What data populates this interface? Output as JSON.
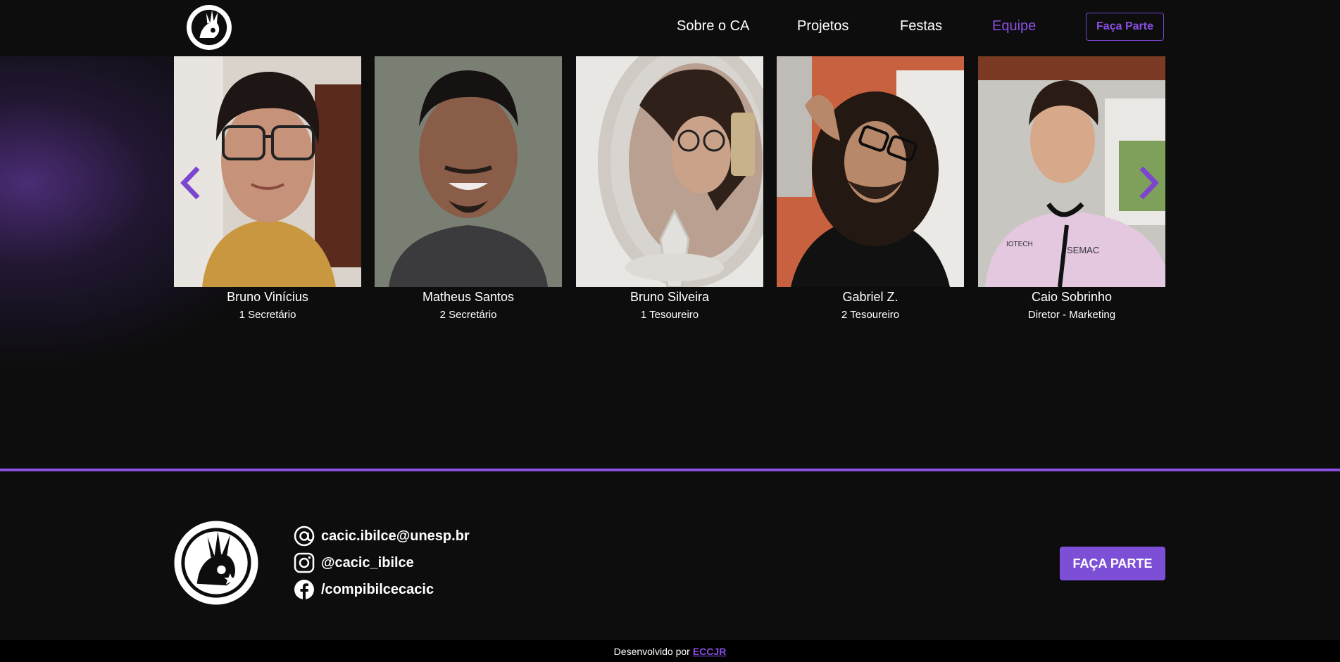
{
  "header": {
    "nav": [
      {
        "label": "Sobre o CA"
      },
      {
        "label": "Projetos"
      },
      {
        "label": "Festas"
      },
      {
        "label": "Equipe",
        "active": true
      }
    ],
    "cta_label": "Faça Parte"
  },
  "team": {
    "members": [
      {
        "name": "Bruno Vinícius",
        "role": "1 Secretário"
      },
      {
        "name": "Matheus Santos",
        "role": "2 Secretário"
      },
      {
        "name": "Bruno Silveira",
        "role": "1 Tesoureiro"
      },
      {
        "name": "Gabriel Z.",
        "role": "2 Tesoureiro"
      },
      {
        "name": "Caio Sobrinho",
        "role": "Diretor - Marketing"
      }
    ]
  },
  "footer": {
    "email": "cacic.ibilce@unesp.br",
    "instagram": "@cacic_ibilce",
    "facebook": "/compibilcecacic",
    "cta_label": "FAÇA PARTE",
    "credit_prefix": "Desenvolvido por",
    "credit_link": "ECCJR"
  },
  "colors": {
    "accent": "#8b4fe4",
    "background": "#0d0d0e",
    "button": "#7d4fd6"
  },
  "icons": {
    "logo": "cacic-logo",
    "email": "at-icon",
    "instagram": "instagram-icon",
    "facebook": "facebook-icon",
    "prev": "chevron-left-icon",
    "next": "chevron-right-icon"
  }
}
